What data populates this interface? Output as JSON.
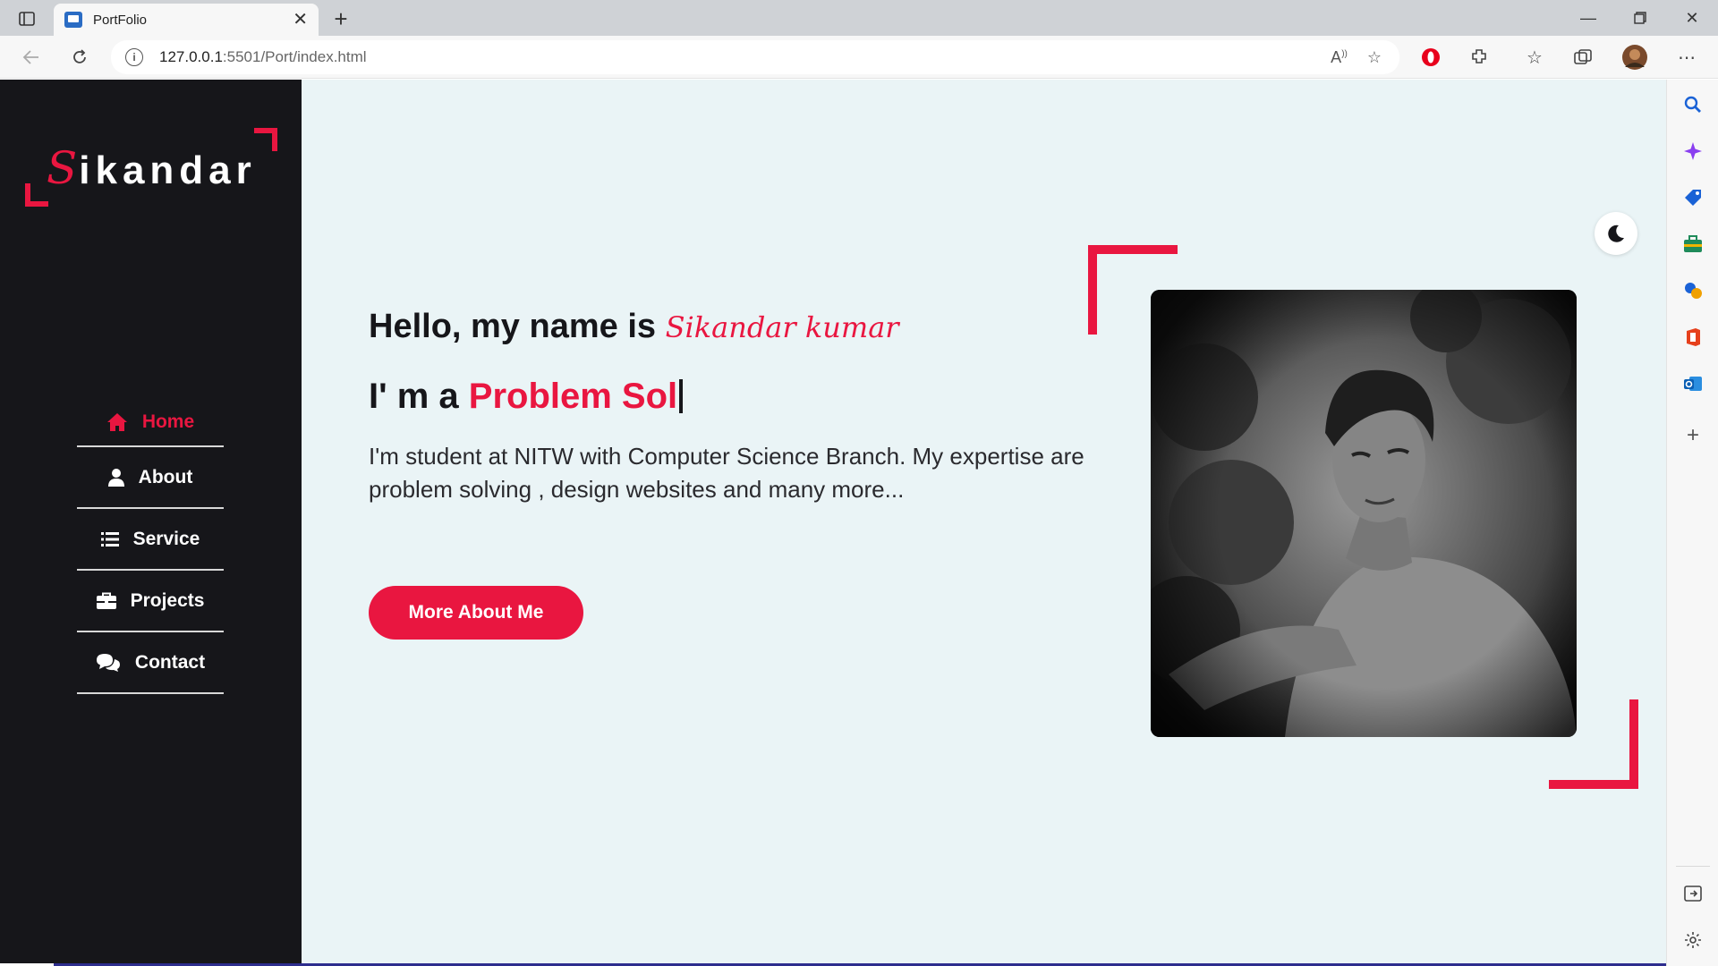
{
  "browser": {
    "tab_title": "PortFolio",
    "url_host": "127.0.0.1",
    "url_rest": ":5501/Port/index.html"
  },
  "logo": {
    "first_letter": "S",
    "rest": "ikandar"
  },
  "nav": [
    {
      "label": "Home",
      "icon": "home-icon",
      "active": true
    },
    {
      "label": "About",
      "icon": "user-icon",
      "active": false
    },
    {
      "label": "Service",
      "icon": "list-icon",
      "active": false
    },
    {
      "label": "Projects",
      "icon": "briefcase-icon",
      "active": false
    },
    {
      "label": "Contact",
      "icon": "comments-icon",
      "active": false
    }
  ],
  "hero": {
    "hello_prefix": "Hello, my name is ",
    "name": "Sikandar kumar",
    "role_prefix": "I' m a ",
    "role_typed": "Problem Sol",
    "description": "I'm student at NITW with Computer Science Branch. My expertise are problem solving , design websites and many more...",
    "button_label": "More About Me"
  },
  "colors": {
    "accent": "#e91640",
    "sidebar_bg": "#16161a",
    "page_bg": "#eaf4f6"
  }
}
